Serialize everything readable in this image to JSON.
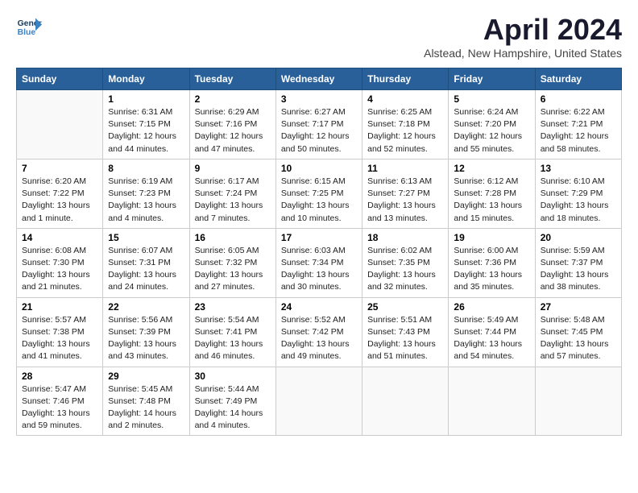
{
  "header": {
    "logo_line1": "General",
    "logo_line2": "Blue",
    "month_title": "April 2024",
    "location": "Alstead, New Hampshire, United States"
  },
  "weekdays": [
    "Sunday",
    "Monday",
    "Tuesday",
    "Wednesday",
    "Thursday",
    "Friday",
    "Saturday"
  ],
  "weeks": [
    [
      {
        "day": "",
        "sunrise": "",
        "sunset": "",
        "daylight": ""
      },
      {
        "day": "1",
        "sunrise": "Sunrise: 6:31 AM",
        "sunset": "Sunset: 7:15 PM",
        "daylight": "Daylight: 12 hours and 44 minutes."
      },
      {
        "day": "2",
        "sunrise": "Sunrise: 6:29 AM",
        "sunset": "Sunset: 7:16 PM",
        "daylight": "Daylight: 12 hours and 47 minutes."
      },
      {
        "day": "3",
        "sunrise": "Sunrise: 6:27 AM",
        "sunset": "Sunset: 7:17 PM",
        "daylight": "Daylight: 12 hours and 50 minutes."
      },
      {
        "day": "4",
        "sunrise": "Sunrise: 6:25 AM",
        "sunset": "Sunset: 7:18 PM",
        "daylight": "Daylight: 12 hours and 52 minutes."
      },
      {
        "day": "5",
        "sunrise": "Sunrise: 6:24 AM",
        "sunset": "Sunset: 7:20 PM",
        "daylight": "Daylight: 12 hours and 55 minutes."
      },
      {
        "day": "6",
        "sunrise": "Sunrise: 6:22 AM",
        "sunset": "Sunset: 7:21 PM",
        "daylight": "Daylight: 12 hours and 58 minutes."
      }
    ],
    [
      {
        "day": "7",
        "sunrise": "Sunrise: 6:20 AM",
        "sunset": "Sunset: 7:22 PM",
        "daylight": "Daylight: 13 hours and 1 minute."
      },
      {
        "day": "8",
        "sunrise": "Sunrise: 6:19 AM",
        "sunset": "Sunset: 7:23 PM",
        "daylight": "Daylight: 13 hours and 4 minutes."
      },
      {
        "day": "9",
        "sunrise": "Sunrise: 6:17 AM",
        "sunset": "Sunset: 7:24 PM",
        "daylight": "Daylight: 13 hours and 7 minutes."
      },
      {
        "day": "10",
        "sunrise": "Sunrise: 6:15 AM",
        "sunset": "Sunset: 7:25 PM",
        "daylight": "Daylight: 13 hours and 10 minutes."
      },
      {
        "day": "11",
        "sunrise": "Sunrise: 6:13 AM",
        "sunset": "Sunset: 7:27 PM",
        "daylight": "Daylight: 13 hours and 13 minutes."
      },
      {
        "day": "12",
        "sunrise": "Sunrise: 6:12 AM",
        "sunset": "Sunset: 7:28 PM",
        "daylight": "Daylight: 13 hours and 15 minutes."
      },
      {
        "day": "13",
        "sunrise": "Sunrise: 6:10 AM",
        "sunset": "Sunset: 7:29 PM",
        "daylight": "Daylight: 13 hours and 18 minutes."
      }
    ],
    [
      {
        "day": "14",
        "sunrise": "Sunrise: 6:08 AM",
        "sunset": "Sunset: 7:30 PM",
        "daylight": "Daylight: 13 hours and 21 minutes."
      },
      {
        "day": "15",
        "sunrise": "Sunrise: 6:07 AM",
        "sunset": "Sunset: 7:31 PM",
        "daylight": "Daylight: 13 hours and 24 minutes."
      },
      {
        "day": "16",
        "sunrise": "Sunrise: 6:05 AM",
        "sunset": "Sunset: 7:32 PM",
        "daylight": "Daylight: 13 hours and 27 minutes."
      },
      {
        "day": "17",
        "sunrise": "Sunrise: 6:03 AM",
        "sunset": "Sunset: 7:34 PM",
        "daylight": "Daylight: 13 hours and 30 minutes."
      },
      {
        "day": "18",
        "sunrise": "Sunrise: 6:02 AM",
        "sunset": "Sunset: 7:35 PM",
        "daylight": "Daylight: 13 hours and 32 minutes."
      },
      {
        "day": "19",
        "sunrise": "Sunrise: 6:00 AM",
        "sunset": "Sunset: 7:36 PM",
        "daylight": "Daylight: 13 hours and 35 minutes."
      },
      {
        "day": "20",
        "sunrise": "Sunrise: 5:59 AM",
        "sunset": "Sunset: 7:37 PM",
        "daylight": "Daylight: 13 hours and 38 minutes."
      }
    ],
    [
      {
        "day": "21",
        "sunrise": "Sunrise: 5:57 AM",
        "sunset": "Sunset: 7:38 PM",
        "daylight": "Daylight: 13 hours and 41 minutes."
      },
      {
        "day": "22",
        "sunrise": "Sunrise: 5:56 AM",
        "sunset": "Sunset: 7:39 PM",
        "daylight": "Daylight: 13 hours and 43 minutes."
      },
      {
        "day": "23",
        "sunrise": "Sunrise: 5:54 AM",
        "sunset": "Sunset: 7:41 PM",
        "daylight": "Daylight: 13 hours and 46 minutes."
      },
      {
        "day": "24",
        "sunrise": "Sunrise: 5:52 AM",
        "sunset": "Sunset: 7:42 PM",
        "daylight": "Daylight: 13 hours and 49 minutes."
      },
      {
        "day": "25",
        "sunrise": "Sunrise: 5:51 AM",
        "sunset": "Sunset: 7:43 PM",
        "daylight": "Daylight: 13 hours and 51 minutes."
      },
      {
        "day": "26",
        "sunrise": "Sunrise: 5:49 AM",
        "sunset": "Sunset: 7:44 PM",
        "daylight": "Daylight: 13 hours and 54 minutes."
      },
      {
        "day": "27",
        "sunrise": "Sunrise: 5:48 AM",
        "sunset": "Sunset: 7:45 PM",
        "daylight": "Daylight: 13 hours and 57 minutes."
      }
    ],
    [
      {
        "day": "28",
        "sunrise": "Sunrise: 5:47 AM",
        "sunset": "Sunset: 7:46 PM",
        "daylight": "Daylight: 13 hours and 59 minutes."
      },
      {
        "day": "29",
        "sunrise": "Sunrise: 5:45 AM",
        "sunset": "Sunset: 7:48 PM",
        "daylight": "Daylight: 14 hours and 2 minutes."
      },
      {
        "day": "30",
        "sunrise": "Sunrise: 5:44 AM",
        "sunset": "Sunset: 7:49 PM",
        "daylight": "Daylight: 14 hours and 4 minutes."
      },
      {
        "day": "",
        "sunrise": "",
        "sunset": "",
        "daylight": ""
      },
      {
        "day": "",
        "sunrise": "",
        "sunset": "",
        "daylight": ""
      },
      {
        "day": "",
        "sunrise": "",
        "sunset": "",
        "daylight": ""
      },
      {
        "day": "",
        "sunrise": "",
        "sunset": "",
        "daylight": ""
      }
    ]
  ]
}
